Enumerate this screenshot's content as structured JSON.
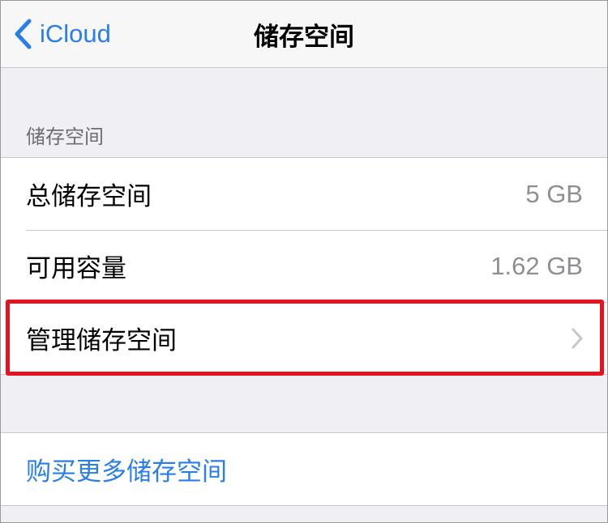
{
  "navbar": {
    "back_label": "iCloud",
    "title": "储存空间"
  },
  "storage_section": {
    "header": "储存空间",
    "rows": [
      {
        "label": "总储存空间",
        "value": "5 GB"
      },
      {
        "label": "可用容量",
        "value": "1.62 GB"
      },
      {
        "label": "管理储存空间",
        "accessory": "chevron-right-icon"
      }
    ]
  },
  "buy_section": {
    "label": "购买更多储存空间"
  },
  "colors": {
    "accent": "#2a7ee8",
    "highlight": "#e8111f",
    "background": "#efeff4"
  }
}
